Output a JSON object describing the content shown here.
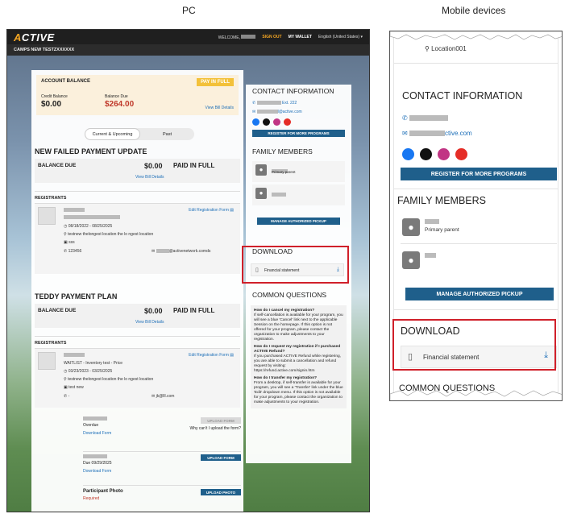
{
  "captions": {
    "pc": "PC",
    "mobile": "Mobile devices"
  },
  "brand": {
    "logo_a": "A",
    "logo_rest": "CTIVE",
    "accent": "#f5a623",
    "primary": "#1f5f8b",
    "link": "#1d6fb8",
    "highlight": "#d0202a"
  },
  "topnav": {
    "welcome": "WELCOME,",
    "signout": "SIGN OUT",
    "wallet": "MY WALLET",
    "language": "English (United States) ▾"
  },
  "account_name": "CAMPS NEW TESTZXXXXXX",
  "balance": {
    "title": "ACCOUNT BALANCE",
    "pay_label": "PAY IN FULL",
    "credit_label": "Credit Balance",
    "credit_value": "$0.00",
    "due_label": "Balance Due",
    "due_value": "$264.00",
    "link": "View Bill Details"
  },
  "tabs": [
    {
      "label": "Current & Upcoming"
    },
    {
      "label": "Past"
    }
  ],
  "orders": [
    {
      "title": "NEW FAILED PAYMENT UPDATE",
      "balance_label": "BALANCE DUE",
      "amount": "$0.00",
      "status": "PAID IN FULL",
      "link": "View Bill Details",
      "registrants_label": "REGISTRANTS",
      "edit_link": "Edit Registration Form",
      "dates": "08/18/2022 - 08/25/2025",
      "location": "testnew thelongest location the lo ngest location",
      "extra": "sss",
      "phone": "123456",
      "email": "@activenetwork.comds"
    },
    {
      "title": "TEDDY PAYMENT PLAN",
      "balance_label": "BALANCE DUE",
      "amount": "$0.00",
      "status": "PAID IN FULL",
      "link": "View Bill Details",
      "registrants_label": "REGISTRANTS",
      "edit_link": "Edit Registration Form",
      "program": "WAITLIST - Inventory test - Price",
      "dates": "03/23/2023 - 03/25/2025",
      "location": "testnew thelongest location the lo ngest location",
      "extra": "test new",
      "phone": "-",
      "email": "jk@lll.com"
    }
  ],
  "forms": [
    {
      "status": "Overdue",
      "link": "Download Form",
      "button": "UPLOAD FORM",
      "question": "Why can't I upload the form?"
    },
    {
      "status": "Due 09/29/2025",
      "link": "Download Form",
      "button": "UPLOAD FORM"
    },
    {
      "title": "Participant Photo",
      "status": "Required",
      "button": "UPLOAD PHOTO"
    }
  ],
  "contact": {
    "title": "CONTACT INFORMATION",
    "ext": "Ext. 222",
    "email_pc": "l@active.com",
    "email_mobile": "ctive.com",
    "register_button": "REGISTER FOR MORE PROGRAMS"
  },
  "family": {
    "title": "FAMILY MEMBERS",
    "primary_role": "Primary parent",
    "manage_button": "MANAGE AUTHORIZED PICKUP"
  },
  "download": {
    "title": "DOWNLOAD",
    "item": "Financial statement"
  },
  "questions": {
    "title": "COMMON QUESTIONS",
    "mobile_title": "COMMON QUESTIONS",
    "items": [
      {
        "q": "How do I cancel my registration?",
        "a": "If self-cancellation is available for your program, you will see a blue 'Cancel' link next to the applicable Session on the homepage. If this option is not offered for your program, please contact the organization to make adjustments to your registration."
      },
      {
        "q": "How do I request my registration if I purchased ACTIVE Refund?",
        "a": "If you purchased ACTIVE Refund while registering, you are able to submit a cancellation and refund request by visiting: https://refund.active.com/signin.htm"
      },
      {
        "q": "How do I transfer my registration?",
        "a": "From a desktop, if self-transfer is available for your program, you will see a 'Transfer' link under the blue 'Edit' dropdown menu. If this option is not available for your program, please contact the organization to make adjustments to your registration."
      }
    ]
  },
  "mobile": {
    "location": "Location001"
  }
}
